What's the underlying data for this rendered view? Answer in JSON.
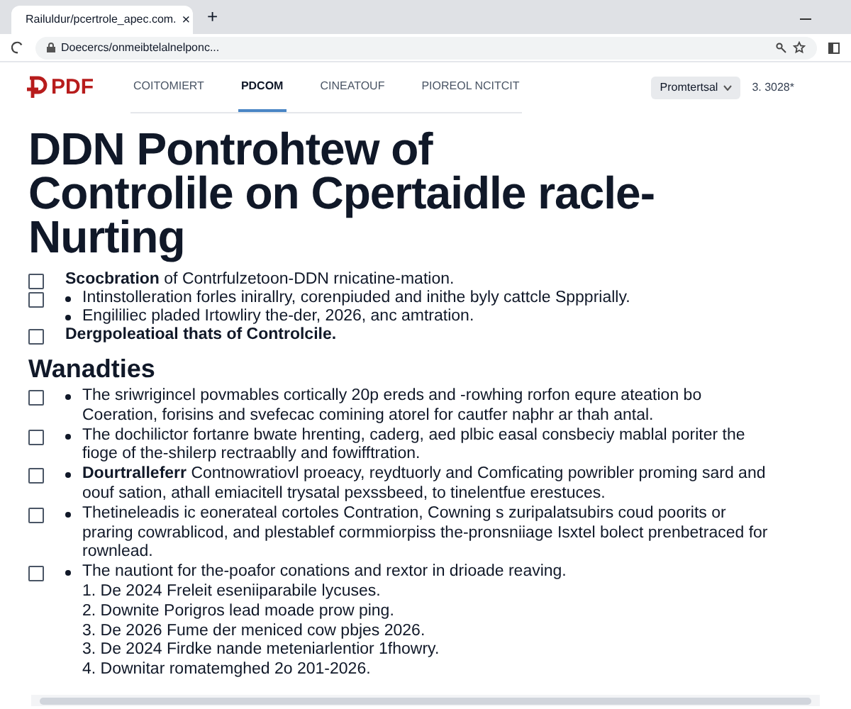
{
  "browser": {
    "tab_title": "Railuldur/pcertrole_apec.com.",
    "close": "×",
    "new_tab": "+",
    "address": "Doecercs/onmeibtelalnelponc..."
  },
  "header": {
    "logo": "PDF",
    "nav": [
      {
        "label": "COITOMIERT",
        "selected": false
      },
      {
        "label": "PDCOM",
        "selected": true
      },
      {
        "label": "CINEATOUF",
        "selected": false
      },
      {
        "label": "PIOREOL NCITCIT",
        "selected": false
      }
    ],
    "dropdown": "Promtertsal",
    "meta": "3. 3028*"
  },
  "title": [
    "DDN Pontrohtew of",
    "Controlile on Cpertaidle racle-",
    "Nurting"
  ],
  "intro_items": [
    {
      "kind": "check",
      "checked": false,
      "text": "**Scocbration** of Contrfulzetoon-DDN rnicatine-mation."
    },
    {
      "kind": "check-bullet",
      "checked": false,
      "text": "Intinstolleration forles inirallry, corenpiuded and inithe byly cattcle Sppprially."
    },
    {
      "kind": "bullet",
      "text": "Engililiec pladed Irtowliry the-der, 2026, anc amtration."
    },
    {
      "kind": "check",
      "checked": false,
      "text": "**Dergpoleatioal thats of Controlcile.**"
    }
  ],
  "section": {
    "heading": "Wanadties",
    "items": [
      {
        "kind": "check-bullet",
        "checked": false,
        "text": "The sriwrigincel povmables cortically 20p ereds and -rowhing rorfon equre ateation bo Coeration, forisins and svefecac comining atorel for cautfer naþhr ar thah antal."
      },
      {
        "kind": "check-bullet",
        "checked": false,
        "text": "The dochilictor fortanre bwate hrenting, caderg, aed plbic easal consbeciy mablal poriter the fioge of the-shilerp rectraablly and fowifftration."
      },
      {
        "kind": "check-bullet",
        "checked": false,
        "text": "**Dourtralleferr** Contnowratiovl proeacy, reydtuorly and Comficating powribler proming sard and oouf sation, athall emiacitell trysatal pexssbeed, to tinelentfue erestuces."
      },
      {
        "kind": "check-bullet",
        "checked": false,
        "text": "Thetineleadis ic eonerateal cortoles Contration, Cowning s zuripalatsubirs coud poorits or praring cowrablicod, and plestablef cormmiorpiss the-pronsniiage Isxtel bolect prenbetraced for rownlead."
      },
      {
        "kind": "check-bullet",
        "checked": false,
        "text": "The nautiont for the-poafor conations and rextor in drioade reaving.",
        "steps": [
          "1. De 2024 Freleit eseniiparabile lycuses.",
          "2. Downite Porigros lead moade prow ping.",
          "3. De 2026 Fume der meniced cow pbjes 2026.",
          "3. De 2024 Firdke nande meteniarlentior 1fhowry.",
          "4. Downitar romatemghed 2o 201-2026."
        ]
      }
    ]
  }
}
